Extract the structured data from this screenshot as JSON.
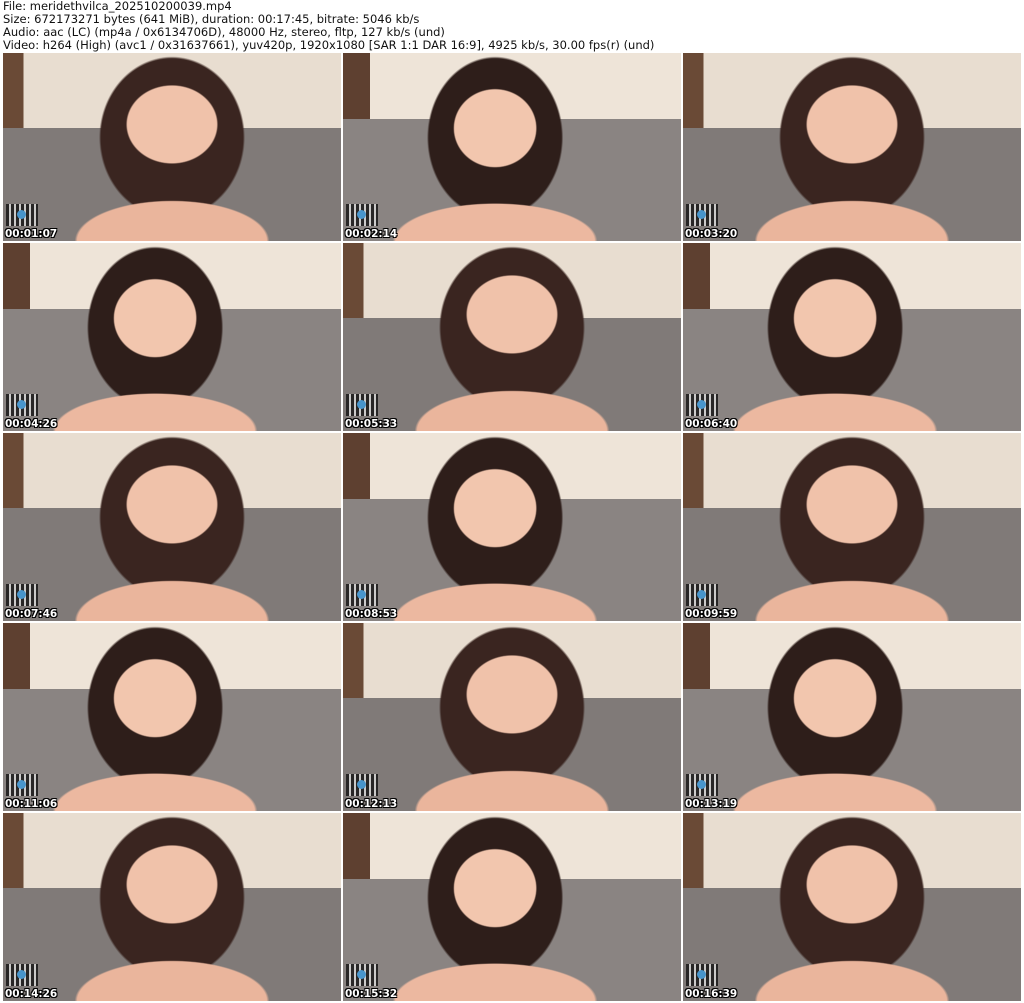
{
  "header": {
    "file": "File: meridethvilca_202510200039.mp4",
    "size": "Size: 672173271 bytes (641 MiB), duration: 00:17:45, bitrate: 5046 kb/s",
    "audio": "Audio: aac (LC) (mp4a / 0x6134706D), 48000 Hz, stereo, fltp, 127 kb/s (und)",
    "video": "Video: h264 (High) (avc1 / 0x31637661), yuv420p, 1920x1080 [SAR 1:1 DAR 16:9], 4925 kb/s, 30.00 fps(r) (und)"
  },
  "thumbnails": [
    {
      "timestamp": "00:01:07"
    },
    {
      "timestamp": "00:02:14"
    },
    {
      "timestamp": "00:03:20"
    },
    {
      "timestamp": "00:04:26"
    },
    {
      "timestamp": "00:05:33"
    },
    {
      "timestamp": "00:06:40"
    },
    {
      "timestamp": "00:07:46"
    },
    {
      "timestamp": "00:08:53"
    },
    {
      "timestamp": "00:09:59"
    },
    {
      "timestamp": "00:11:06"
    },
    {
      "timestamp": "00:12:13"
    },
    {
      "timestamp": "00:13:19"
    },
    {
      "timestamp": "00:14:26"
    },
    {
      "timestamp": "00:15:32"
    },
    {
      "timestamp": "00:16:39"
    }
  ]
}
